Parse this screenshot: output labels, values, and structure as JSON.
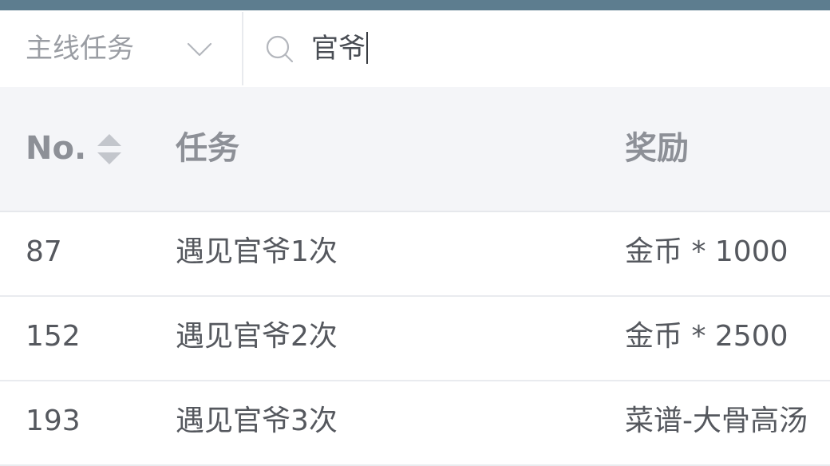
{
  "filter": {
    "selected_category": "主线任务",
    "search_value": "官爷"
  },
  "table": {
    "headers": {
      "no": "No.",
      "task": "任务",
      "reward": "奖励"
    },
    "rows": [
      {
        "no": "87",
        "task": "遇见官爷1次",
        "reward": "金币 * 1000"
      },
      {
        "no": "152",
        "task": "遇见官爷2次",
        "reward": "金币 * 2500"
      },
      {
        "no": "193",
        "task": "遇见官爷3次",
        "reward": "菜谱-大骨高汤"
      }
    ]
  },
  "icons": {
    "select": "chevron-down-icon",
    "search": "search-icon",
    "sort": "sort-icon"
  },
  "colors": {
    "top_bar": "#5d7d8f",
    "header_background": "#f4f5f8"
  }
}
